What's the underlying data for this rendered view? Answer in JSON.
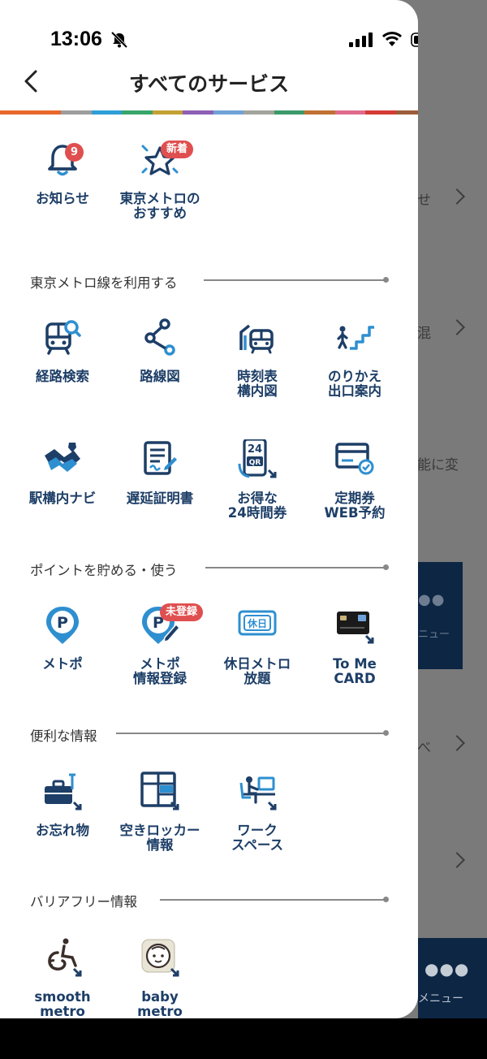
{
  "status_bar": {
    "time": "13:06"
  },
  "header": {
    "title": "すべてのサービス"
  },
  "stripe_colors": [
    "#e8682c",
    "#e8682c",
    "#9d9d9d",
    "#2e9fd7",
    "#38a66b",
    "#c4a135",
    "#8d5fb5",
    "#6fa3d8",
    "#a2a39c",
    "#3c9a6a",
    "#c07133",
    "#e06b8d",
    "#d43c35",
    "#9c5d3a",
    "#8fb23f",
    "#e1327b"
  ],
  "background": {
    "row_texts": [
      "せ",
      "混",
      "能に変",
      "べ"
    ],
    "card_label": "ニュー",
    "tab_label": "メニュー"
  },
  "top": {
    "notice": {
      "label": "お知らせ",
      "badge": "9",
      "icon": "bell-icon"
    },
    "recommend": {
      "label": "東京メトロの\nおすすめ",
      "badge": "新着",
      "icon": "star-icon"
    }
  },
  "sections": {
    "metro": {
      "title": "東京メトロ線を利用する",
      "items": [
        {
          "label": "経路検索",
          "icon": "train-search-icon"
        },
        {
          "label": "路線図",
          "icon": "route-map-icon"
        },
        {
          "label": "時刻表\n構内図",
          "icon": "timetable-icon"
        },
        {
          "label": "のりかえ\n出口案内",
          "icon": "stairs-icon"
        },
        {
          "label": "駅構内ナビ",
          "icon": "station-navi-icon"
        },
        {
          "label": "遅延証明書",
          "icon": "certificate-icon"
        },
        {
          "label": "お得な\n24時間券",
          "icon": "qr-ticket-icon",
          "icon_text_top": "24",
          "icon_text_bottom": "QR"
        },
        {
          "label": "定期券\nWEB予約",
          "icon": "commuter-pass-icon"
        }
      ]
    },
    "points": {
      "title": "ポイントを貯める・使う",
      "items": [
        {
          "label": "メトポ",
          "icon": "metpo-icon"
        },
        {
          "label": "メトポ\n情報登録",
          "icon": "metpo-register-icon",
          "badge": "未登録"
        },
        {
          "label": "休日メトロ\n放題",
          "icon": "holiday-ticket-icon",
          "icon_text": "休日"
        },
        {
          "label": "To Me\nCARD",
          "icon": "credit-card-icon"
        }
      ]
    },
    "info": {
      "title": "便利な情報",
      "items": [
        {
          "label": "お忘れ物",
          "icon": "lost-item-icon"
        },
        {
          "label": "空きロッカー\n情報",
          "icon": "locker-icon"
        },
        {
          "label": "ワーク\nスペース",
          "icon": "workspace-icon"
        }
      ]
    },
    "barrier": {
      "title": "バリアフリー情報",
      "items": [
        {
          "label": "smooth\nmetro",
          "icon": "wheelchair-icon"
        },
        {
          "label": "baby\nmetro",
          "icon": "baby-icon"
        }
      ]
    }
  }
}
